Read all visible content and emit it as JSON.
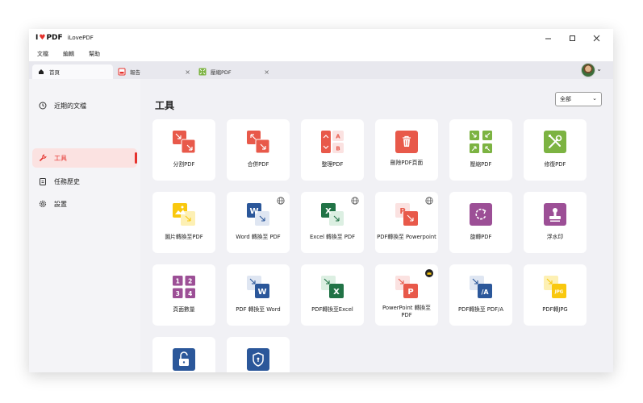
{
  "app": {
    "logo_i": "I",
    "logo_pdf": "PDF",
    "title": "iLovePDF"
  },
  "window_controls": {
    "minimize": "—",
    "maximize": "☐",
    "close": "✕"
  },
  "menu": [
    "文檔",
    "編輯",
    "幫助"
  ],
  "tabs": [
    {
      "label": "首頁",
      "icon": "home-icon"
    },
    {
      "label": "報告",
      "icon": "pdf-file-icon"
    },
    {
      "label": "壓縮PDF",
      "icon": "compress-icon"
    }
  ],
  "sidebar": {
    "items": [
      {
        "label": "近期的文檔",
        "icon": "clock-icon"
      },
      {
        "label": "工具",
        "icon": "wrench-icon"
      },
      {
        "label": "任務歷史",
        "icon": "clipboard-icon"
      },
      {
        "label": "設置",
        "icon": "gear-icon"
      }
    ]
  },
  "main": {
    "title": "工具",
    "filter": {
      "selected": "全部"
    },
    "tools": [
      {
        "label": "分割PDF",
        "color": "#e8594a"
      },
      {
        "label": "合併PDF",
        "color": "#e8594a"
      },
      {
        "label": "整理PDF",
        "color": "#e8594a"
      },
      {
        "label": "刪除PDF頁面",
        "color": "#e8594a"
      },
      {
        "label": "壓縮PDF",
        "color": "#7cb342"
      },
      {
        "label": "修復PDF",
        "color": "#7cb342"
      },
      {
        "label": "圖片轉換至PDF",
        "color": "#f9c80e"
      },
      {
        "label": "Word 轉換至 PDF",
        "color": "#2b579a"
      },
      {
        "label": "Excel 轉換至 PDF",
        "color": "#217346"
      },
      {
        "label": "PDF轉換至 Powerpoint",
        "color": "#e8594a"
      },
      {
        "label": "旋轉PDF",
        "color": "#9c4f96"
      },
      {
        "label": "浮水印",
        "color": "#9c4f96"
      },
      {
        "label": "頁面數量",
        "color": "#9c4f96"
      },
      {
        "label": "PDF 轉換至 Word",
        "color": "#2b579a"
      },
      {
        "label": "PDF轉換至Excel",
        "color": "#217346"
      },
      {
        "label": "PowerPoint 轉換至 PDF",
        "color": "#e8594a"
      },
      {
        "label": "PDF轉換至 PDF/A",
        "color": "#2b579a"
      },
      {
        "label": "PDF轉JPG",
        "color": "#f9c80e"
      },
      {
        "label": "",
        "color": "#2b579a"
      },
      {
        "label": "",
        "color": "#2b579a"
      }
    ]
  }
}
